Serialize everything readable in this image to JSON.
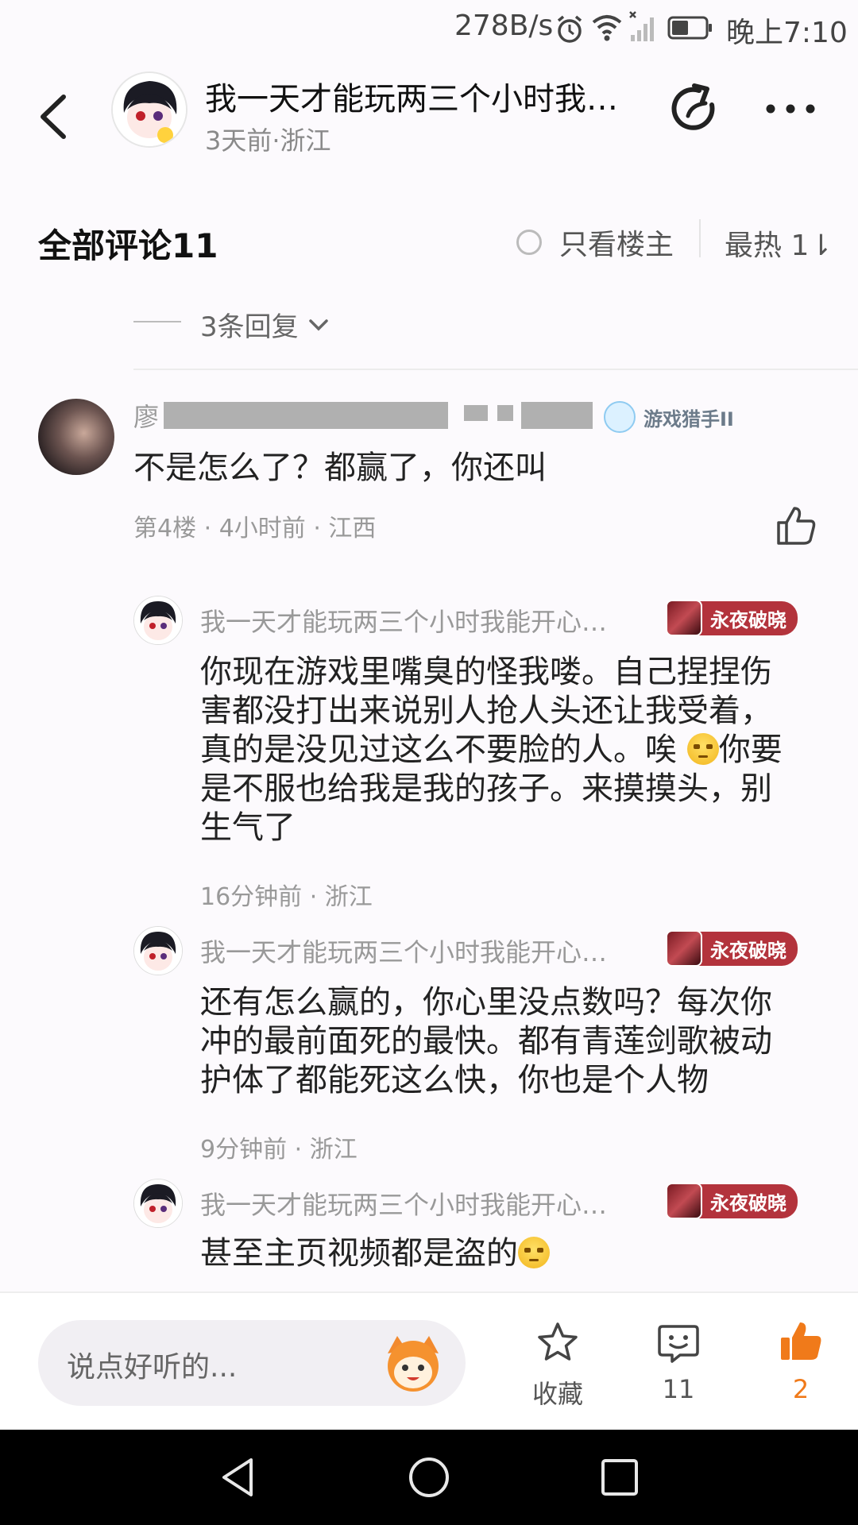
{
  "status_bar": {
    "network_speed": "278B/s",
    "time": "晚上7:10",
    "icons": [
      "alarm-icon",
      "wifi-icon",
      "signal-icon",
      "battery-icon"
    ]
  },
  "header": {
    "title": "我一天才能玩两三个小时我…",
    "meta": "3天前·浙江",
    "icons": [
      "back-icon",
      "share-icon",
      "more-icon"
    ]
  },
  "comment_bar": {
    "title": "全部评论11",
    "op_only_label": "只看楼主",
    "sort_label": "最热 1⇂"
  },
  "replies_toggle": {
    "label": "3条回复"
  },
  "main_comment": {
    "name_visible": "廖",
    "badge": "游戏猎手II",
    "text": "不是怎么了？都赢了，你还叫",
    "meta": "第4楼 · 4小时前 · 江西"
  },
  "replies": [
    {
      "name": "我一天才能玩两三个小时我能开心…",
      "badge": "永夜破晓",
      "lines": [
        "你现在游戏里嘴臭的怪我喽。自己捏捏伤",
        "害都没打出来说别人抢人头还让我受着，",
        "真的是没见过这么不要脸的人。唉",
        "你要",
        "是不服也给我是我的孩子。来摸摸头，别",
        "生气了"
      ],
      "meta": "16分钟前 · 浙江"
    },
    {
      "name": "我一天才能玩两三个小时我能开心…",
      "badge": "永夜破晓",
      "lines": [
        "还有怎么赢的，你心里没点数吗？每次你",
        "冲的最前面死的最快。都有青莲剑歌被动",
        "护体了都能死这么快，你也是个人物"
      ],
      "meta": "9分钟前 · 浙江"
    },
    {
      "name": "我一天才能玩两三个小时我能开心…",
      "badge": "永夜破晓",
      "lines": [
        "甚至主页视频都是盗的"
      ]
    }
  ],
  "bottom_bar": {
    "input_placeholder": "说点好听的...",
    "favorite_label": "收藏",
    "comment_count": "11",
    "like_count": "2",
    "accent_color": "#f07a1a"
  },
  "nav_bar": {
    "icons": [
      "nav-back-icon",
      "nav-home-icon",
      "nav-recents-icon"
    ]
  }
}
